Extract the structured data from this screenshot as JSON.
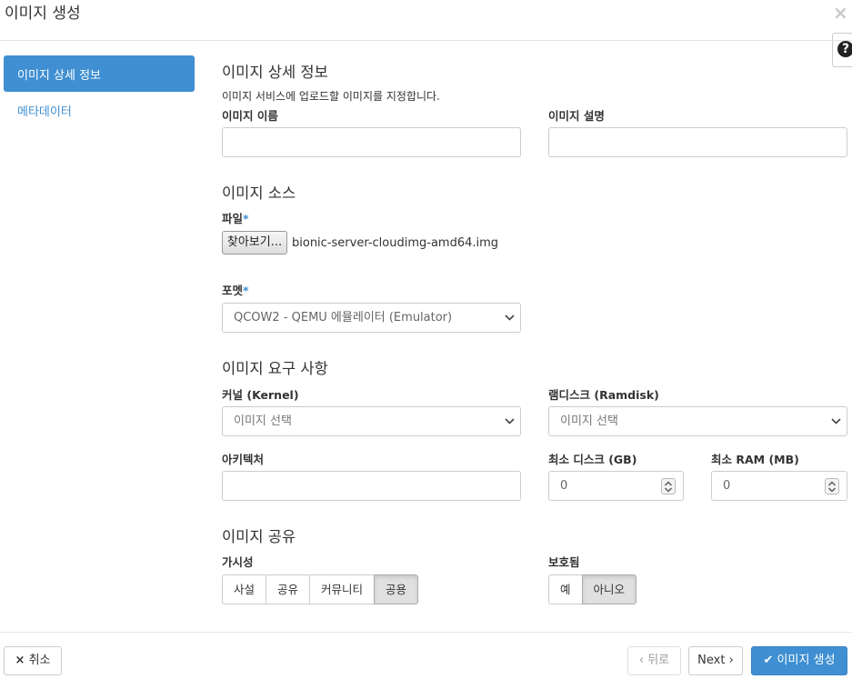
{
  "modal": {
    "title": "이미지 생성",
    "close_icon": "×",
    "help_icon": "?"
  },
  "sidebar": {
    "items": [
      {
        "label": "이미지 상세 정보",
        "active": true
      },
      {
        "label": "메타데이터",
        "active": false
      }
    ]
  },
  "details": {
    "heading": "이미지 상세 정보",
    "help": "이미지 서비스에 업로드할 이미지를 지정합니다.",
    "name_label": "이미지 이름",
    "name_value": "",
    "description_label": "이미지 설명",
    "description_value": ""
  },
  "source": {
    "heading": "이미지 소스",
    "file_label": "파일",
    "required_mark": "*",
    "browse_label": "찾아보기...",
    "file_name": "bionic-server-cloudimg-amd64.img",
    "format_label": "포멧",
    "format_value": "QCOW2 - QEMU 에뮬레이터 (Emulator)"
  },
  "requirements": {
    "heading": "이미지 요구 사항",
    "kernel_label": "커널 (Kernel)",
    "kernel_value": "이미지 선택",
    "ramdisk_label": "램디스크 (Ramdisk)",
    "ramdisk_value": "이미지 선택",
    "architecture_label": "아키텍처",
    "architecture_value": "",
    "min_disk_label": "최소 디스크 (GB)",
    "min_disk_value": "0",
    "min_ram_label": "최소 RAM (MB)",
    "min_ram_value": "0"
  },
  "sharing": {
    "heading": "이미지 공유",
    "visibility_label": "가시성",
    "visibility_options": [
      "사설",
      "공유",
      "커뮤니티",
      "공용"
    ],
    "visibility_selected": "공용",
    "protected_label": "보호됨",
    "protected_options": [
      "예",
      "아니오"
    ],
    "protected_selected": "아니오"
  },
  "footer": {
    "cancel_label": "취소",
    "cancel_icon": "×",
    "back_label": "뒤로",
    "back_icon": "‹",
    "next_label": "Next",
    "next_icon": "›",
    "create_label": "이미지 생성",
    "create_icon": "✔"
  },
  "colors": {
    "accent": "#3f8fd2",
    "border": "#cccccc",
    "active_segment": "#e0e0e0"
  }
}
